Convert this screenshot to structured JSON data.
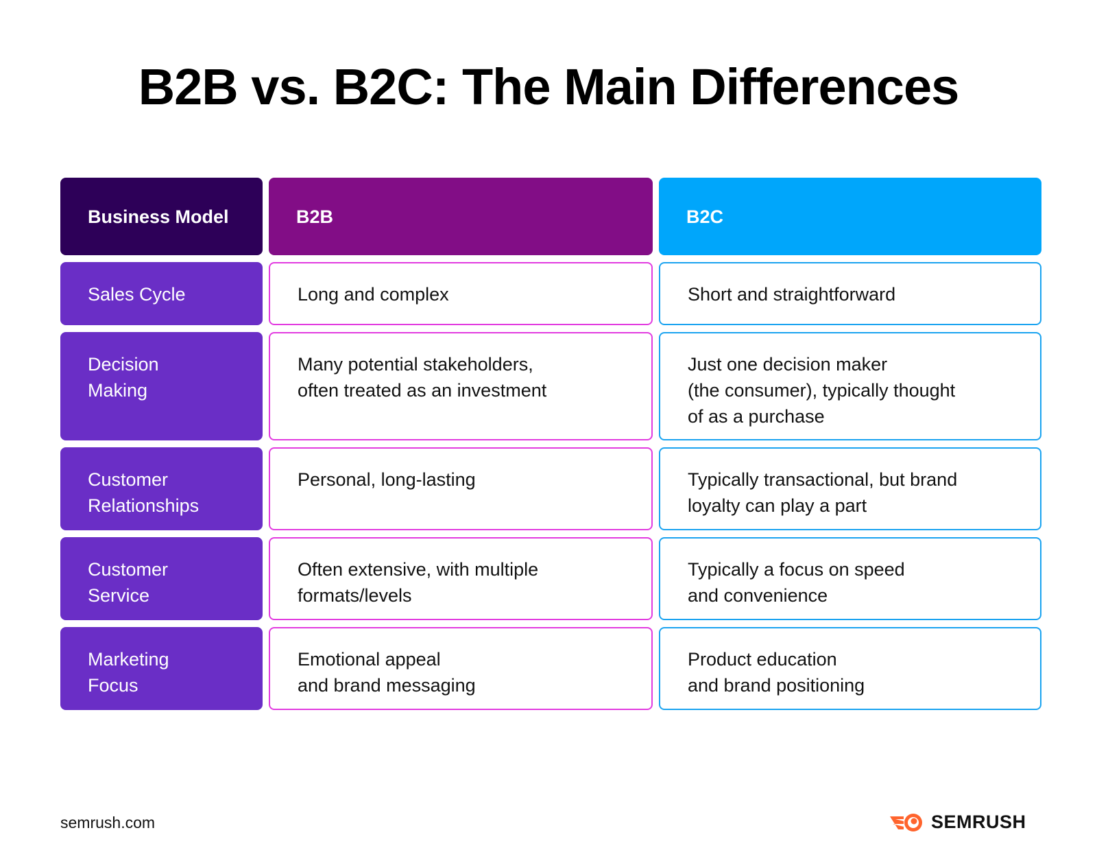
{
  "title": "B2B vs. B2C: The Main Differences",
  "table": {
    "headers": [
      "Business Model",
      "B2B",
      "B2C"
    ],
    "rows": [
      {
        "label": [
          "Sales Cycle"
        ],
        "b2b": [
          "Long and complex"
        ],
        "b2c": [
          "Short and straightforward"
        ]
      },
      {
        "label": [
          "Decision",
          "Making"
        ],
        "b2b": [
          "Many potential stakeholders,",
          "often treated as an investment"
        ],
        "b2c": [
          "Just one decision maker",
          "(the consumer), typically thought",
          "of as a purchase"
        ]
      },
      {
        "label": [
          "Customer",
          "Relationships"
        ],
        "b2b": [
          "Personal, long-lasting"
        ],
        "b2c": [
          "Typically transactional, but brand",
          "loyalty can play a part"
        ]
      },
      {
        "label": [
          "Customer",
          "Service"
        ],
        "b2b": [
          "Often extensive, with multiple",
          "formats/levels"
        ],
        "b2c": [
          "Typically a focus on speed",
          "and convenience"
        ]
      },
      {
        "label": [
          "Marketing",
          "Focus"
        ],
        "b2b": [
          "Emotional appeal",
          "and brand messaging"
        ],
        "b2c": [
          "Product education",
          "and brand positioning"
        ]
      }
    ]
  },
  "colors": {
    "header_label": "#2d0058",
    "header_b2b": "#820d86",
    "header_b2c": "#00a6fb",
    "row_label": "#6a2ec6",
    "b2b_border": "#e23be0",
    "b2c_border": "#1aa3f0",
    "brand_orange": "#ff642d"
  },
  "footer": {
    "site": "semrush.com",
    "brand": "SEMRUSH",
    "brand_icon": "semrush-fireball-icon"
  }
}
